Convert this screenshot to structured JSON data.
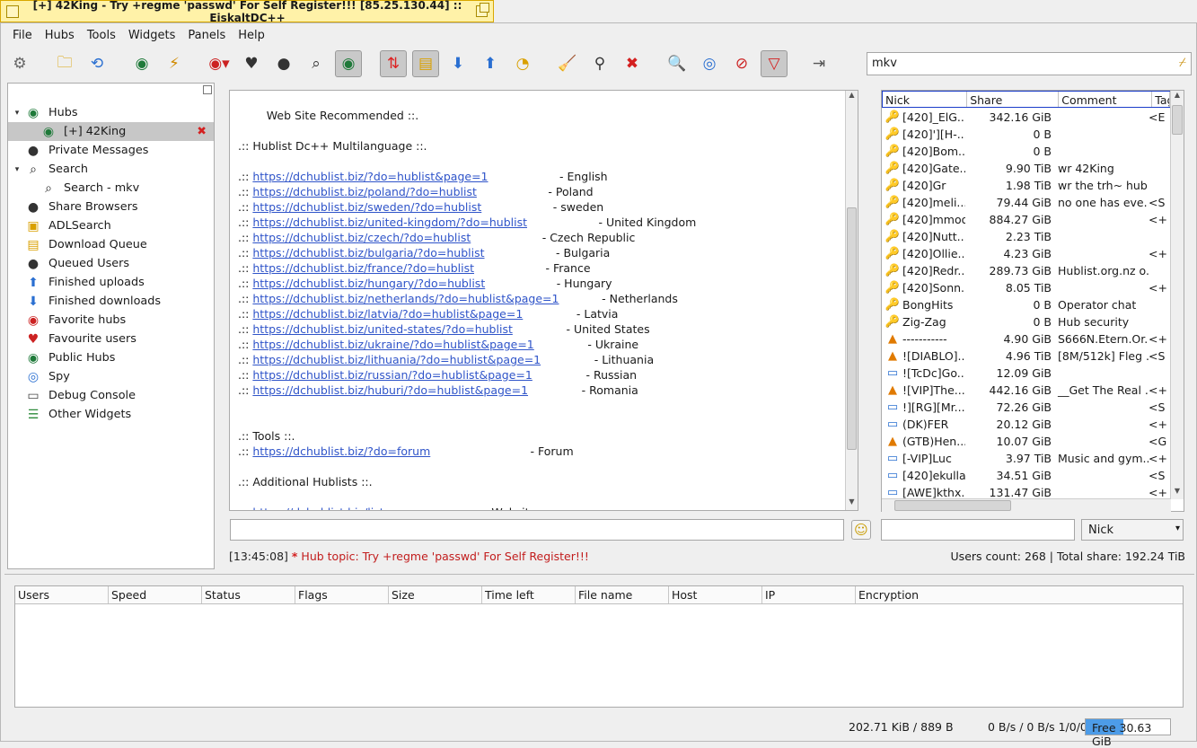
{
  "window_title": "[+] 42King - Try +regme 'passwd' For Self Register!!! [85.25.130.44] :: EiskaltDC++",
  "menu": [
    "File",
    "Hubs",
    "Tools",
    "Widgets",
    "Panels",
    "Help"
  ],
  "search": {
    "value": "mkv"
  },
  "sidebar": [
    {
      "label": "Hubs",
      "icon": "globe-icon",
      "arrow": "▾",
      "indent": 0
    },
    {
      "label": "[+] 42King",
      "icon": "globe-icon",
      "indent": 1,
      "selected": true,
      "close": true
    },
    {
      "label": "Private Messages",
      "icon": "user-icon",
      "indent": 0
    },
    {
      "label": "Search",
      "icon": "magnifier-icon",
      "arrow": "▾",
      "indent": 0
    },
    {
      "label": "Search - mkv",
      "icon": "magnifier-icon",
      "indent": 1
    },
    {
      "label": "Share Browsers",
      "icon": "user-icon",
      "indent": 0
    },
    {
      "label": "ADLSearch",
      "icon": "folder-search-icon",
      "indent": 0
    },
    {
      "label": "Download Queue",
      "icon": "folder-queue-icon",
      "indent": 0
    },
    {
      "label": "Queued Users",
      "icon": "user-icon",
      "indent": 0
    },
    {
      "label": "Finished uploads",
      "icon": "upload-icon",
      "indent": 0
    },
    {
      "label": "Finished downloads",
      "icon": "download-icon",
      "indent": 0
    },
    {
      "label": "Favorite hubs",
      "icon": "globe-heart-icon",
      "indent": 0
    },
    {
      "label": "Favourite users",
      "icon": "user-heart-icon",
      "indent": 0
    },
    {
      "label": "Public Hubs",
      "icon": "globe-icon",
      "indent": 0
    },
    {
      "label": "Spy",
      "icon": "eye-icon",
      "indent": 0
    },
    {
      "label": "Debug Console",
      "icon": "console-icon",
      "indent": 0
    },
    {
      "label": "Other Widgets",
      "icon": "sliders-icon",
      "indent": 0
    }
  ],
  "chat": [
    {
      "pre": "        Web Site Recommended ::.",
      "url": "",
      "post": ""
    },
    {
      "pre": "",
      "url": "",
      "post": ""
    },
    {
      "pre": ".:: Hublist Dc++ Multilanguage ::.",
      "url": "",
      "post": ""
    },
    {
      "pre": "",
      "url": "",
      "post": ""
    },
    {
      "pre": ".:: ",
      "url": "https://dchublist.biz/?do=hublist&page=1",
      "post": "                    - English"
    },
    {
      "pre": ".:: ",
      "url": "https://dchublist.biz/poland/?do=hublist",
      "post": "                    - Poland"
    },
    {
      "pre": ".:: ",
      "url": "https://dchublist.biz/sweden/?do=hublist",
      "post": "                    - sweden"
    },
    {
      "pre": ".:: ",
      "url": "https://dchublist.biz/united-kingdom/?do=hublist",
      "post": "                    - United Kingdom"
    },
    {
      "pre": ".:: ",
      "url": "https://dchublist.biz/czech/?do=hublist",
      "post": "                    - Czech Republic"
    },
    {
      "pre": ".:: ",
      "url": "https://dchublist.biz/bulgaria/?do=hublist",
      "post": "                    - Bulgaria"
    },
    {
      "pre": ".:: ",
      "url": "https://dchublist.biz/france/?do=hublist",
      "post": "                    - France"
    },
    {
      "pre": ".:: ",
      "url": "https://dchublist.biz/hungary/?do=hublist",
      "post": "                    - Hungary"
    },
    {
      "pre": ".:: ",
      "url": "https://dchublist.biz/netherlands/?do=hublist&page=1",
      "post": "            - Netherlands"
    },
    {
      "pre": ".:: ",
      "url": "https://dchublist.biz/latvia/?do=hublist&page=1",
      "post": "               - Latvia"
    },
    {
      "pre": ".:: ",
      "url": "https://dchublist.biz/united-states/?do=hublist",
      "post": "               - United States"
    },
    {
      "pre": ".:: ",
      "url": "https://dchublist.biz/ukraine/?do=hublist&page=1",
      "post": "               - Ukraine"
    },
    {
      "pre": ".:: ",
      "url": "https://dchublist.biz/lithuania/?do=hublist&page=1",
      "post": "               - Lithuania"
    },
    {
      "pre": ".:: ",
      "url": "https://dchublist.biz/russian/?do=hublist&page=1",
      "post": "               - Russian"
    },
    {
      "pre": ".:: ",
      "url": "https://dchublist.biz/huburi/?do=hublist&page=1",
      "post": "               - Romania"
    },
    {
      "pre": "",
      "url": "",
      "post": ""
    },
    {
      "pre": "",
      "url": "",
      "post": ""
    },
    {
      "pre": ".:: Tools ::.",
      "url": "",
      "post": ""
    },
    {
      "pre": ".:: ",
      "url": "https://dchublist.biz/?do=forum",
      "post": "                            - Forum"
    },
    {
      "pre": "",
      "url": "",
      "post": ""
    },
    {
      "pre": ".:: Additional Hublists ::.",
      "url": "",
      "post": ""
    },
    {
      "pre": "",
      "url": "",
      "post": ""
    },
    {
      "pre": ".:: ",
      "url": "https://dchublist.biz/list",
      "post": "                            - Website"
    }
  ],
  "userlist": {
    "columns": [
      "Nick",
      "Share",
      "Comment",
      "Tag"
    ],
    "rows": [
      {
        "icon": "key-icon",
        "nick": "[420]_ElG...",
        "share": "342.16 GiB",
        "comment": "",
        "tag": "<E"
      },
      {
        "icon": "key-icon",
        "nick": "[420]'][H-...",
        "share": "0 B",
        "comment": "",
        "tag": ""
      },
      {
        "icon": "key-icon",
        "nick": "[420]Bom...",
        "share": "0 B",
        "comment": "",
        "tag": ""
      },
      {
        "icon": "key-icon",
        "nick": "[420]Gate...",
        "share": "9.90 TiB",
        "comment": "wr  42King",
        "tag": ""
      },
      {
        "icon": "key-icon",
        "nick": "[420]Gr",
        "share": "1.98 TiB",
        "comment": "wr  the trh~ hub",
        "tag": ""
      },
      {
        "icon": "key-icon",
        "nick": "[420]meli...",
        "share": "79.44 GiB",
        "comment": "no one has eve...",
        "tag": "<S"
      },
      {
        "icon": "key-icon",
        "nick": "[420]mmoo",
        "share": "884.27 GiB",
        "comment": "",
        "tag": "<+"
      },
      {
        "icon": "key-icon",
        "nick": "[420]Nutt...",
        "share": "2.23 TiB",
        "comment": "",
        "tag": ""
      },
      {
        "icon": "key-icon",
        "nick": "[420]Ollie...",
        "share": "4.23 GiB",
        "comment": "",
        "tag": "<+"
      },
      {
        "icon": "key-icon",
        "nick": "[420]Redr...",
        "share": "289.73 GiB",
        "comment": "Hublist.org.nz o...",
        "tag": ""
      },
      {
        "icon": "key-icon",
        "nick": "[420]Sonn...",
        "share": "8.05 TiB",
        "comment": "",
        "tag": "<+"
      },
      {
        "icon": "key-icon",
        "nick": "BongHits",
        "share": "0 B",
        "comment": "Operator chat",
        "tag": ""
      },
      {
        "icon": "key-icon",
        "nick": "Zig-Zag",
        "share": "0 B",
        "comment": "Hub security",
        "tag": ""
      },
      {
        "icon": "cone-icon",
        "nick": "-----------",
        "share": "4.90 GiB",
        "comment": "S666N.Etern.Or...",
        "tag": "<+"
      },
      {
        "icon": "cone-icon",
        "nick": "![DIABLO]...",
        "share": "4.96 TiB",
        "comment": "[8M/512k] Fleg ...",
        "tag": "<S"
      },
      {
        "icon": "monitor-icon",
        "nick": "![TcDc]Go...",
        "share": "12.09 GiB",
        "comment": "",
        "tag": ""
      },
      {
        "icon": "cone-icon",
        "nick": "![VIP]The...",
        "share": "442.16 GiB",
        "comment": "__Get The Real ...",
        "tag": "<+"
      },
      {
        "icon": "monitor-icon",
        "nick": "!][RG][Mr...",
        "share": "72.26 GiB",
        "comment": "",
        "tag": "<S"
      },
      {
        "icon": "monitor-icon",
        "nick": "(DK)FER",
        "share": "20.12 GiB",
        "comment": "",
        "tag": "<+"
      },
      {
        "icon": "cone-icon",
        "nick": "(GTB)Hen...",
        "share": "10.07 GiB",
        "comment": "",
        "tag": "<G"
      },
      {
        "icon": "monitor-icon",
        "nick": "[-VIP]Luc",
        "share": "3.97 TiB",
        "comment": "Music and gym...",
        "tag": "<+"
      },
      {
        "icon": "monitor-icon",
        "nick": "[420]ekulla",
        "share": "34.51 GiB",
        "comment": "",
        "tag": "<S"
      },
      {
        "icon": "monitor-icon",
        "nick": "[AWE]kthx...",
        "share": "131.47 GiB",
        "comment": "",
        "tag": "<+"
      }
    ]
  },
  "nick_select": "Nick",
  "status": {
    "time": "[13:45:08]",
    "star": "*",
    "message": "Hub topic: Try +regme 'passwd' For Self Register!!!"
  },
  "users_count": "Users count: 268  |  Total share: 192.24 TiB",
  "transfers": {
    "columns": [
      "Users",
      "Speed",
      "Status",
      "Flags",
      "Size",
      "Time left",
      "File name",
      "Host",
      "IP",
      "Encryption"
    ]
  },
  "statusbar": {
    "bytes": "202.71 KiB / 889 B",
    "speed": "0 B/s / 0 B/s  1/0/0",
    "free": "Free 30.63 GiB",
    "free_fraction": 0.45
  }
}
